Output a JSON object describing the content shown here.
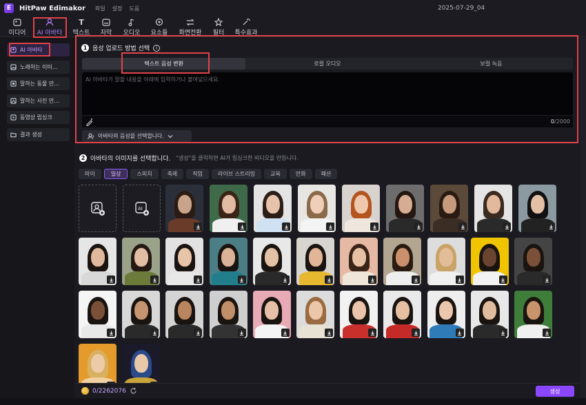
{
  "app": {
    "title": "HitPaw Edimakor",
    "date": "2025-07-29_04"
  },
  "menu": [
    "파일",
    "설정",
    "도움"
  ],
  "toolbar": [
    {
      "label": "미디어",
      "icon": "media-icon"
    },
    {
      "label": "AI 아바타",
      "icon": "ai-avatar-icon"
    },
    {
      "label": "텍스트",
      "icon": "text-icon"
    },
    {
      "label": "자막",
      "icon": "subtitle-icon"
    },
    {
      "label": "오디오",
      "icon": "audio-icon"
    },
    {
      "label": "요소들",
      "icon": "elements-icon"
    },
    {
      "label": "화면전환",
      "icon": "transition-icon"
    },
    {
      "label": "필터",
      "icon": "filter-icon"
    },
    {
      "label": "특수효과",
      "icon": "effects-icon"
    }
  ],
  "sidebar": [
    {
      "label": "AI 아바타",
      "icon": "avatar-icon"
    },
    {
      "label": "노래하는 이미...",
      "icon": "image-icon"
    },
    {
      "label": "말하는 동물 만...",
      "icon": "animal-icon"
    },
    {
      "label": "말하는 사진 만...",
      "icon": "photo-icon"
    },
    {
      "label": "동영상 립싱크",
      "icon": "video-icon"
    },
    {
      "label": "결과 생성",
      "icon": "folder-icon"
    }
  ],
  "step1": {
    "num": "1",
    "title": "음성 업로드 방법 선택",
    "options": [
      "텍스트 음성 변환",
      "로컬 오디오",
      "보컬 녹음"
    ],
    "placeholder": "AI 아바타가 말할 내용을 아래에 입력하거나 붙여넣으세요.",
    "count": "0",
    "max": "/2000",
    "voice_select": "아바타의 음성을 선택합니다."
  },
  "step2": {
    "num": "2",
    "title": "아바타의 이미지를 선택합니다.",
    "hint": "\"생성\"을 클릭하면 AI가 립싱크한 비디오을 만듭니다.",
    "tabs": [
      "마이",
      "일상",
      "스피치",
      "축제",
      "직업",
      "라이브 스트리밍",
      "교육",
      "만화",
      "패션"
    ]
  },
  "footer": {
    "credits": "0/2262076",
    "generate": "생성"
  }
}
